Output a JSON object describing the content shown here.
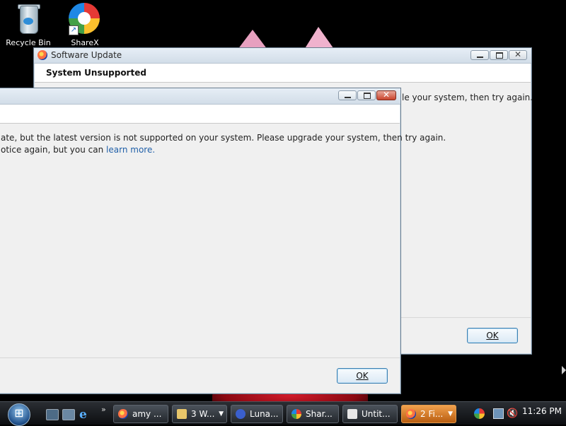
{
  "desktop": {
    "icons": [
      {
        "label": "Recycle Bin",
        "icon": "recycle-bin-icon"
      },
      {
        "label": "ShareX",
        "icon": "sharex-icon"
      }
    ]
  },
  "window_back": {
    "title": "Software Update",
    "header": "System Unsupported",
    "text_visible": "le your system, then try again.",
    "ok_label": "OK"
  },
  "window_front": {
    "title": "",
    "line1": "ate, but the latest version is not supported on your system. Please upgrade your system, then try again.",
    "line2_prefix": "otice again, but you can ",
    "line2_link": "learn more.",
    "ok_label": "OK"
  },
  "taskbar": {
    "buttons": [
      {
        "label": "amy ...",
        "icon": "firefox-icon",
        "has_dropdown": false,
        "active": false
      },
      {
        "label": "3 W...",
        "icon": "folder-icon",
        "has_dropdown": true,
        "active": false
      },
      {
        "label": "Luna...",
        "icon": "app-icon",
        "has_dropdown": false,
        "active": false
      },
      {
        "label": "Shar...",
        "icon": "sharex-icon",
        "has_dropdown": false,
        "active": false
      },
      {
        "label": "Untit...",
        "icon": "paint-icon",
        "has_dropdown": false,
        "active": false
      },
      {
        "label": "2 Fi...",
        "icon": "firefox-icon",
        "has_dropdown": true,
        "active": true
      }
    ],
    "clock": "11:26 PM"
  },
  "colors": {
    "link": "#1f5fa8",
    "active_task": "#d77a28",
    "desktop_bg": "#000000"
  }
}
